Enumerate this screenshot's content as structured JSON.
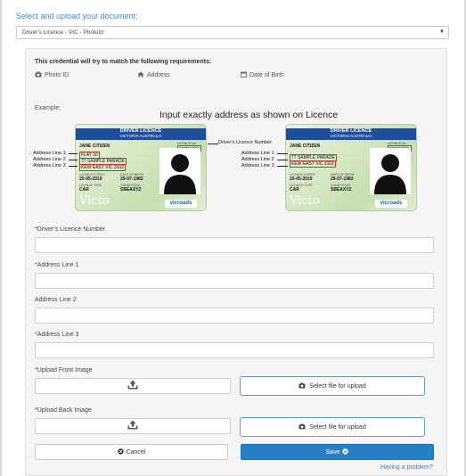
{
  "heading": "Select and upload your document:",
  "document_select": {
    "value": "Driver's Licence - VIC - PhotoId"
  },
  "requirements": {
    "title": "This credential will try to match the following requirements:",
    "items": [
      {
        "label": "Photo ID",
        "icon": "camera-icon"
      },
      {
        "label": "Address",
        "icon": "home-icon"
      },
      {
        "label": "Date of Birth",
        "icon": "calendar-icon"
      }
    ]
  },
  "example": {
    "label": "Example:",
    "title": "Input exactly address as shown on Licence",
    "callouts": {
      "licence_number": "Driver's Licence Number",
      "address_line_1": "Address Line 1",
      "address_line_2": "Address Line 2",
      "address_line_3": "Address Line 3"
    },
    "cards": [
      {
        "header": "DRIVER LICENCE",
        "subheader": "VICTORIA AUSTRALIA",
        "name": "JANE CITIZEN",
        "licence_no_label": "LICENCE No.",
        "licence_no": "987654321",
        "address_lines": [
          "FLAT 10",
          "77 SAMPLE PARADE",
          "KEW EAST VIC 3102"
        ],
        "expiry_label": "LICENCE EXPIRY",
        "expiry": "20-05-2019",
        "dob_label": "DATE OF BIRTH",
        "dob": "29-07-1983",
        "type_label": "LICENCE TYPE",
        "type": "CAR",
        "conditions_label": "CONDITIONS",
        "conditions": "SBEAXYZ",
        "watermark": "Victo",
        "brand": "vicroads"
      },
      {
        "header": "DRIVER LICENCE",
        "subheader": "VICTORIA AUSTRALIA",
        "name": "JANE CITIZEN",
        "licence_no_label": "LICENCE No.",
        "licence_no": "987654321",
        "address_lines": [
          "77 SAMPLE PARADE",
          "KEW EAST VIC 3102"
        ],
        "expiry_label": "LICENCE EXPIRY",
        "expiry": "20-05-2019",
        "dob_label": "DATE OF BIRTH",
        "dob": "29-07-1983",
        "type_label": "LICENCE TYPE",
        "type": "CAR",
        "conditions_label": "CONDITIONS",
        "conditions": "SBEAXYZ",
        "watermark": "Victo",
        "brand": "vicroads"
      }
    ]
  },
  "form": {
    "licence_number_label": "*Driver's Licence Number",
    "address1_label": "*Address Line 1",
    "address2_label": "Address Line 2",
    "address3_label": "*Address Line 3",
    "upload_front_label": "*Upload Front Image",
    "upload_back_label": "*Upload Back Image",
    "select_file_label": "Select file for upload",
    "cancel_label": "Cancel",
    "save_label": "Save",
    "problem_link": "Having a problem?"
  },
  "colors": {
    "accent": "#2680c6",
    "heading": "#4a86c5",
    "highlight": "#c0392b",
    "card_header": "#1f4e9a"
  }
}
